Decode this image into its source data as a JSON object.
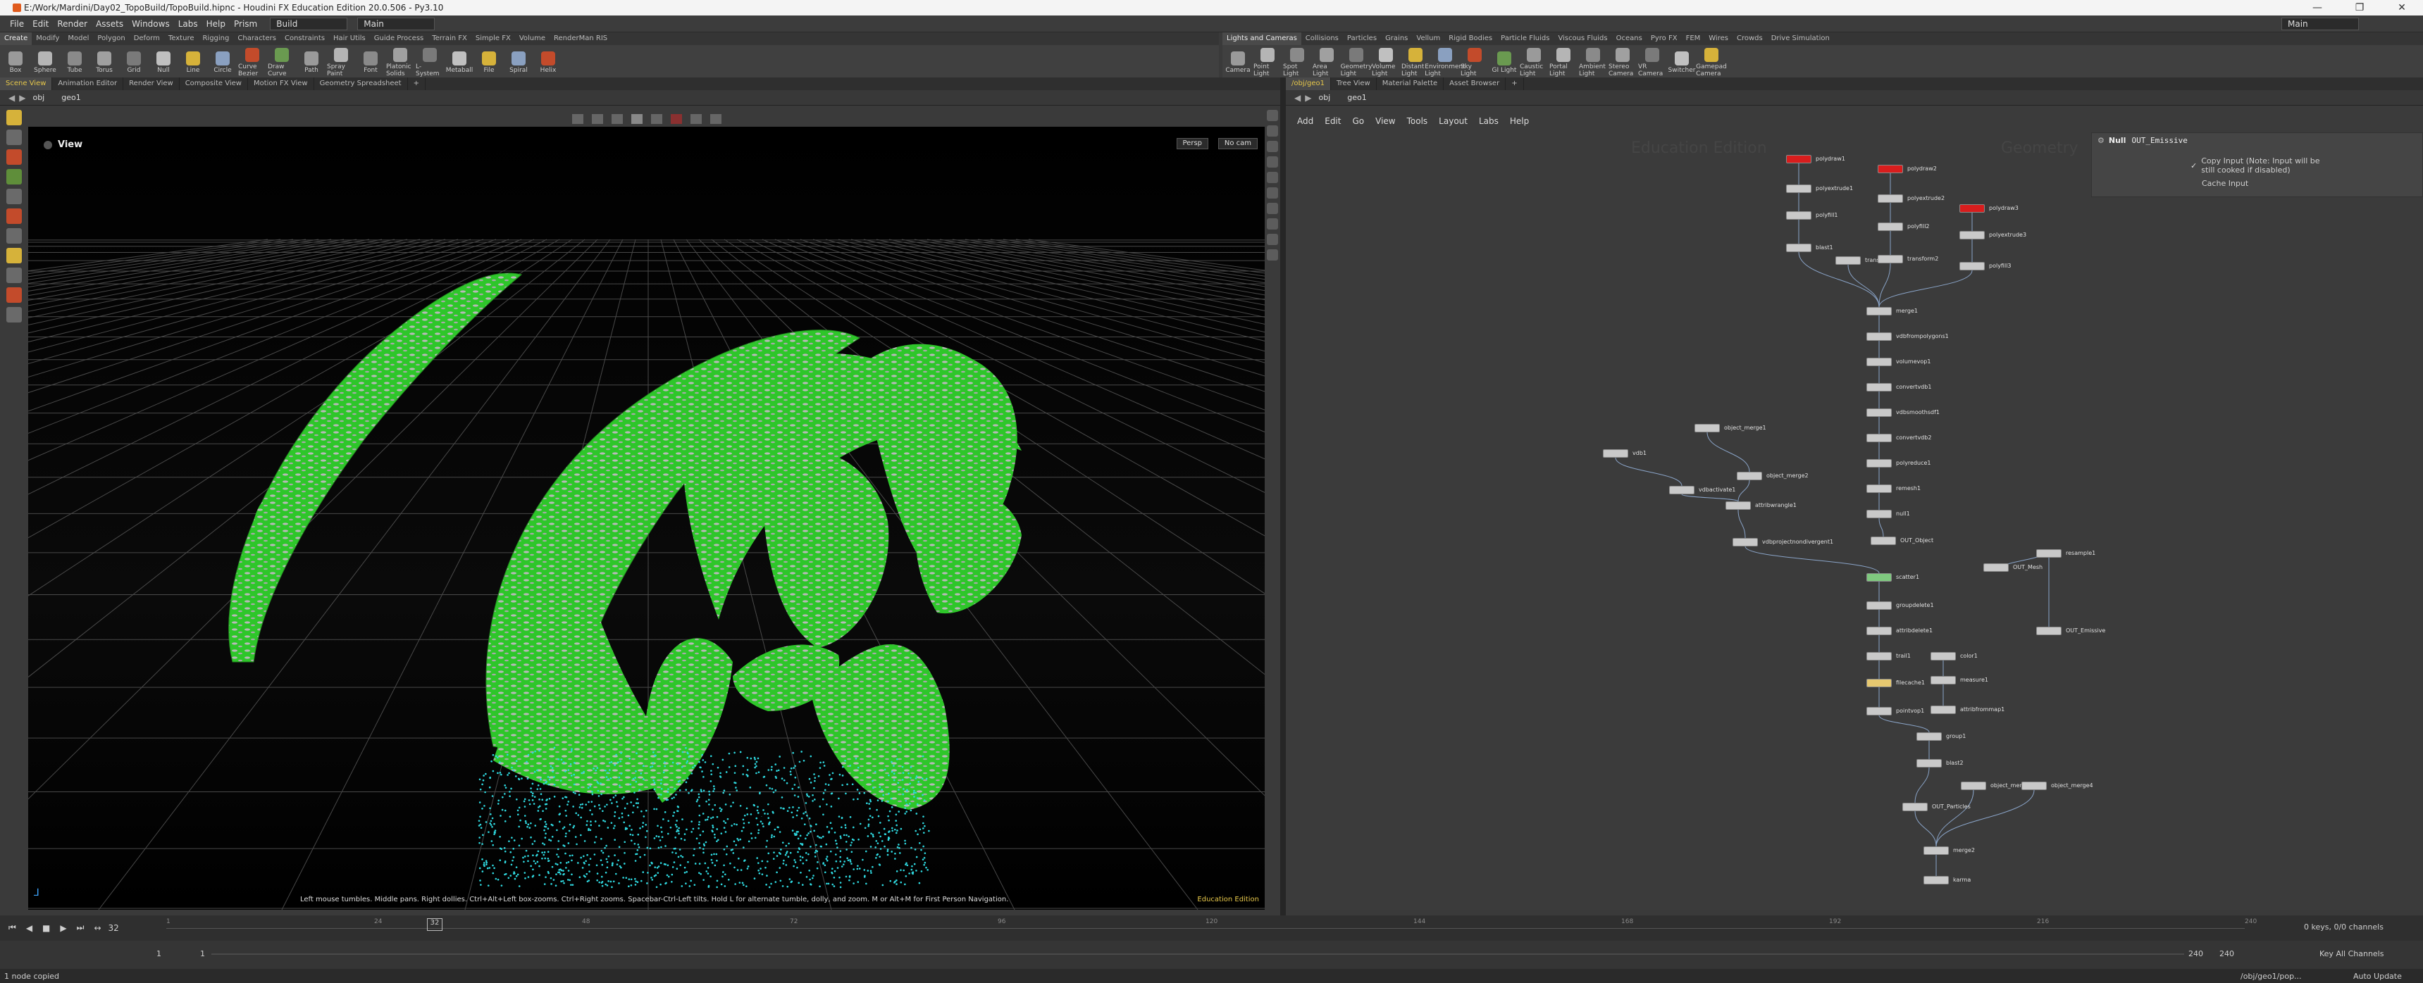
{
  "window": {
    "title": "E:/Work/Mardini/Day02_TopoBuild/TopoBuild.hipnc - Houdini FX Education Edition 20.0.506 - Py3.10",
    "controls": [
      "—",
      "❐",
      "✕"
    ]
  },
  "menubar": {
    "items": [
      "File",
      "Edit",
      "Render",
      "Assets",
      "Windows",
      "Labs",
      "Help",
      "Prism"
    ],
    "desktop": "Build",
    "desktop_main": "Main",
    "right_main": "Main"
  },
  "shelf_left": {
    "tabs": [
      "Create",
      "Modify",
      "Model",
      "Polygon",
      "Deform",
      "Texture",
      "Rigging",
      "Characters",
      "Constraints",
      "Hair Utils",
      "Guide Process",
      "Terrain FX",
      "Simple FX",
      "Volume",
      "RenderMan RIS"
    ],
    "tools": [
      "Box",
      "Sphere",
      "Tube",
      "Torus",
      "Grid",
      "Null",
      "Line",
      "Circle",
      "Curve Bezier",
      "Draw Curve",
      "Path",
      "Spray Paint",
      "Font",
      "Platonic Solids",
      "L-System",
      "Metaball",
      "File",
      "Spiral",
      "Helix"
    ]
  },
  "shelf_right": {
    "tabs": [
      "Lights and Cameras",
      "Collisions",
      "Particles",
      "Grains",
      "Vellum",
      "Rigid Bodies",
      "Particle Fluids",
      "Viscous Fluids",
      "Oceans",
      "Pyro FX",
      "FEM",
      "Wires",
      "Crowds",
      "Drive Simulation"
    ],
    "tools": [
      "Camera",
      "Point Light",
      "Spot Light",
      "Area Light",
      "Geometry Light",
      "Volume Light",
      "Distant Light",
      "Environment Light",
      "Sky Light",
      "GI Light",
      "Caustic Light",
      "Portal Light",
      "Ambient Light",
      "Stereo Camera",
      "VR Camera",
      "Switcher",
      "Gamepad Camera"
    ]
  },
  "left_panel": {
    "tabs": [
      "Scene View",
      "Animation Editor",
      "Render View",
      "Composite View",
      "Motion FX View",
      "Geometry Spreadsheet"
    ],
    "path": [
      "obj",
      "geo1"
    ],
    "view_label": "View",
    "persp": "Persp",
    "cam": "No cam",
    "hint": "Left mouse tumbles. Middle pans. Right dollies. Ctrl+Alt+Left box-zooms. Ctrl+Right zooms. Spacebar-Ctrl-Left tilts. Hold L for alternate tumble, dolly, and zoom. M or Alt+M for First Person Navigation.",
    "edition": "Education Edition"
  },
  "right_panel": {
    "tabs": [
      "/obj/geo1",
      "Tree View",
      "Material Palette",
      "Asset Browser"
    ],
    "path": [
      "obj",
      "geo1"
    ],
    "menu": [
      "Add",
      "Edit",
      "Go",
      "View",
      "Tools",
      "Layout",
      "Labs",
      "Help"
    ],
    "watermark_left": "Education Edition",
    "watermark_right": "Geometry",
    "parm": {
      "node_type": "Null",
      "node_name": "OUT_Emissive",
      "opt1": "Copy Input (Note: Input will be still cooked if disabled)",
      "opt2": "Cache Input"
    }
  },
  "nodes": [
    {
      "label": "polydraw1",
      "color": "red"
    },
    {
      "label": "polydraw2",
      "color": "red"
    },
    {
      "label": "polydraw3",
      "color": "red"
    },
    {
      "label": "polyextrude1",
      "color": "gray"
    },
    {
      "label": "polyextrude2",
      "color": "gray"
    },
    {
      "label": "polyextrude3",
      "color": "gray"
    },
    {
      "label": "polyfill1",
      "color": "gray"
    },
    {
      "label": "polyfill2",
      "color": "gray"
    },
    {
      "label": "polyfill3",
      "color": "gray"
    },
    {
      "label": "blast1",
      "color": "gray"
    },
    {
      "label": "transform1",
      "color": "gray"
    },
    {
      "label": "transform2",
      "color": "gray"
    },
    {
      "label": "merge1",
      "color": "gray"
    },
    {
      "label": "vdbfrompolygons1",
      "color": "gray"
    },
    {
      "label": "volumevop1",
      "color": "gray"
    },
    {
      "label": "convertvdb1",
      "color": "gray"
    },
    {
      "label": "vdbsmoothsdf1",
      "color": "gray"
    },
    {
      "label": "convertvdb2",
      "color": "gray"
    },
    {
      "label": "polyreduce1",
      "color": "gray"
    },
    {
      "label": "remesh1",
      "color": "gray"
    },
    {
      "label": "null1",
      "color": "gray"
    },
    {
      "label": "OUT_Object",
      "color": "gray"
    },
    {
      "label": "object_merge1",
      "color": "gray"
    },
    {
      "label": "object_merge2",
      "color": "gray"
    },
    {
      "label": "vdb1",
      "color": "gray"
    },
    {
      "label": "vdbactivate1",
      "color": "gray"
    },
    {
      "label": "attribwrangle1",
      "color": "gray"
    },
    {
      "label": "vdbprojectnondivergent1",
      "color": "gray"
    },
    {
      "label": "scatter1",
      "color": "green"
    },
    {
      "label": "groupdelete1",
      "color": "gray"
    },
    {
      "label": "attribdelete1",
      "color": "gray"
    },
    {
      "label": "trail1",
      "color": "gray"
    },
    {
      "label": "filecache1",
      "color": "yellow"
    },
    {
      "label": "pointvop1",
      "color": "gray"
    },
    {
      "label": "color1",
      "color": "gray"
    },
    {
      "label": "measure1",
      "color": "gray"
    },
    {
      "label": "attribfrommap1",
      "color": "gray"
    },
    {
      "label": "group1",
      "color": "gray"
    },
    {
      "label": "blast2",
      "color": "gray"
    },
    {
      "label": "OUT_Mesh",
      "color": "gray"
    },
    {
      "label": "resample1",
      "color": "gray"
    },
    {
      "label": "OUT_Emissive",
      "color": "gray"
    },
    {
      "label": "OUT_Particles",
      "color": "gray"
    },
    {
      "label": "object_merge3",
      "color": "gray"
    },
    {
      "label": "object_merge4",
      "color": "gray"
    },
    {
      "label": "merge2",
      "color": "gray"
    },
    {
      "label": "karma",
      "color": "gray"
    }
  ],
  "timeline": {
    "ticks": [
      "1",
      "24",
      "48",
      "72",
      "96",
      "120",
      "144",
      "168",
      "192",
      "216",
      "240"
    ],
    "frame": "32",
    "start": "1",
    "start2": "1",
    "end": "240",
    "end2": "240",
    "channels": "0 keys, 0/0 channels",
    "keyall": "Key All Channels"
  },
  "status": {
    "left": "1 node copied",
    "path": "/obj/geo1/pop...",
    "update": "Auto Update"
  },
  "colors": {
    "mesh": "#2ec62a",
    "particles": "#2fd9e0",
    "node_red": "#d81d1d",
    "accent": "#e6c74a"
  }
}
